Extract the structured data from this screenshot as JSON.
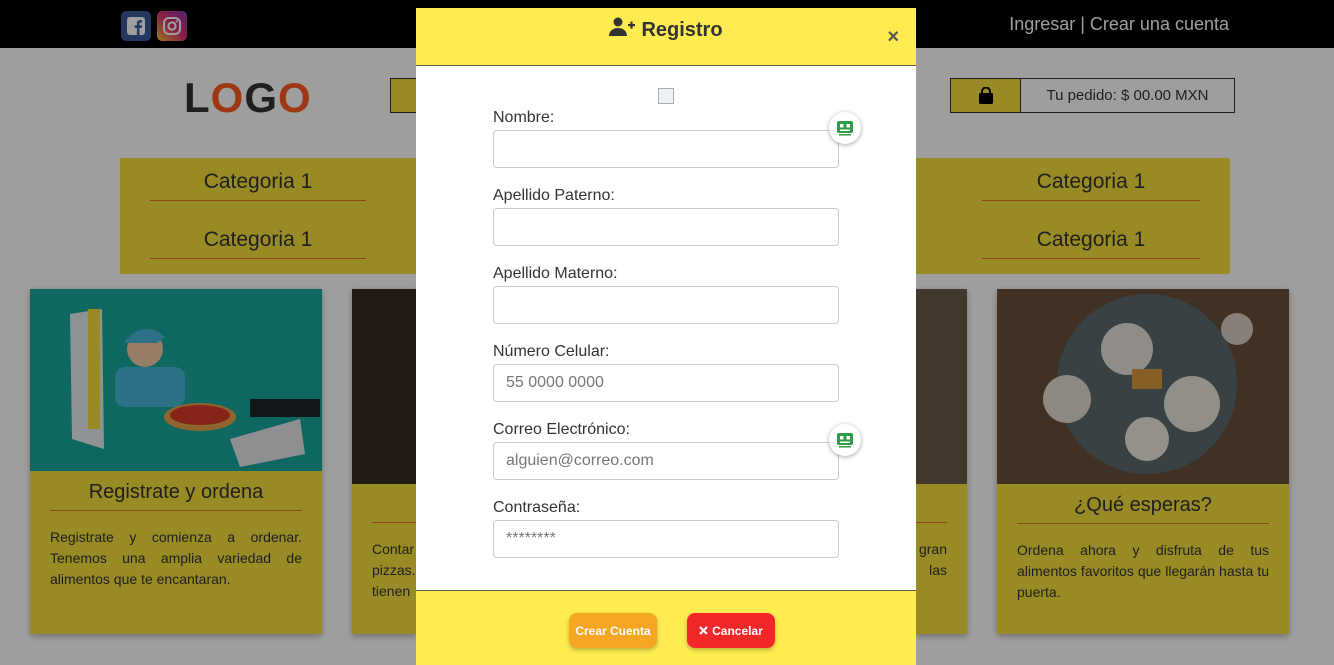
{
  "header": {
    "auth_links": "Ingresar | Crear una cuenta"
  },
  "logo": {
    "l1": "L",
    "l2": "O",
    "l3": "G",
    "l4": "O"
  },
  "cart": {
    "label": "Tu pedido: $ 00.00 MXN",
    "icon": "shopping-bag-icon"
  },
  "categories": [
    "Categoria 1",
    "Categoria 1",
    "Categoria 1",
    "Categoria 1"
  ],
  "cards": [
    {
      "title": "Registrate y ordena",
      "text": "Registrate y comienza a ordenar. Tenemos una amplia variedad de alimentos que te encantaran."
    },
    {
      "text": "Contar\npizzas.\ntienen"
    },
    {
      "text": "gran\nlas"
    },
    {
      "title": "¿Qué esperas?",
      "text": "Ordena ahora y disfruta de tus alimentos favoritos que llegarán hasta tu puerta."
    }
  ],
  "modal": {
    "title": "Registro",
    "close": "×",
    "fields": [
      {
        "label": "Nombre:",
        "placeholder": "",
        "type": "text"
      },
      {
        "label": "Apellido Paterno:",
        "placeholder": "",
        "type": "text"
      },
      {
        "label": "Apellido Materno:",
        "placeholder": "",
        "type": "text"
      },
      {
        "label": "Número Celular:",
        "placeholder": "55 0000 0000",
        "type": "tel"
      },
      {
        "label": "Correo Electrónico:",
        "placeholder": "alguien@correo.com",
        "type": "email"
      },
      {
        "label": "Contraseña:",
        "placeholder": "********",
        "type": "password"
      }
    ],
    "create_button": "Crear Cuenta",
    "cancel_button": "Cancelar"
  },
  "colors": {
    "accent_yellow": "#ffec50",
    "create_orange": "#f5a623",
    "cancel_red": "#f22727"
  }
}
